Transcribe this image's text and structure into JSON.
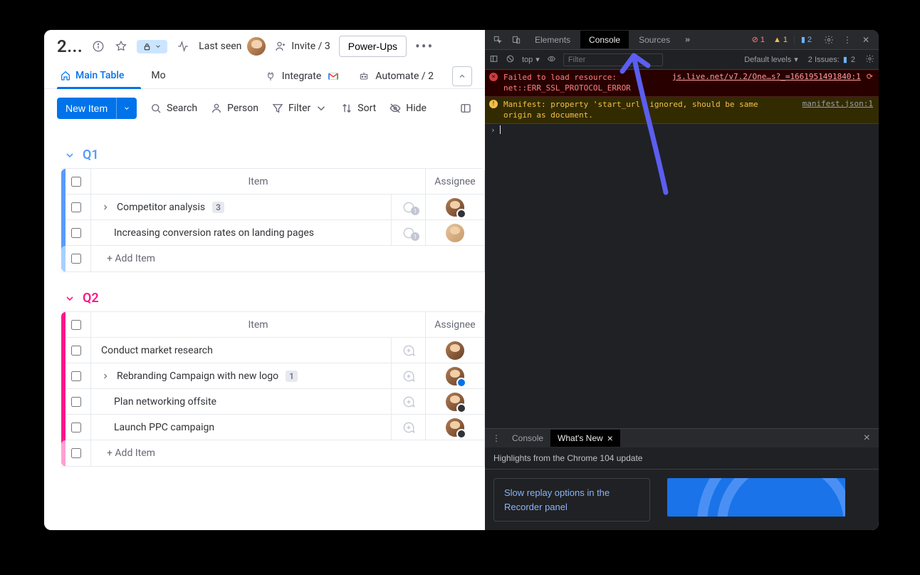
{
  "header": {
    "board_title": "2...",
    "last_seen_label": "Last seen",
    "invite_label": "Invite / 3",
    "powerups_label": "Power-Ups"
  },
  "view_tabs": {
    "main": "Main Table",
    "secondary": "Mo",
    "integrate": "Integrate",
    "automate": "Automate / 2"
  },
  "toolbar": {
    "new_item": "New Item",
    "search": "Search",
    "person": "Person",
    "filter": "Filter",
    "sort": "Sort",
    "hide": "Hide"
  },
  "columns": {
    "item": "Item",
    "assignee": "Assignee"
  },
  "groups": [
    {
      "id": "q1",
      "title": "Q1",
      "color": "blue",
      "rows": [
        {
          "name": "Competitor analysis",
          "badge": "3",
          "expandable": true,
          "chat_count": "1",
          "sub_badge": "moon"
        },
        {
          "name": "Increasing conversion rates on landing pages",
          "indent": true,
          "chat_count": "1",
          "avatar_variant": "light"
        }
      ],
      "add_label": "+ Add Item"
    },
    {
      "id": "q2",
      "title": "Q2",
      "color": "pink",
      "rows": [
        {
          "name": "Conduct market research",
          "chat_plus": true
        },
        {
          "name": "Rebranding Campaign with new logo",
          "badge": "1",
          "expandable": true,
          "chat_plus": true,
          "sub_badge": "home"
        },
        {
          "name": "Plan networking offsite",
          "indent": true,
          "chat_plus": true,
          "sub_badge": "moon"
        },
        {
          "name": "Launch PPC campaign",
          "indent": true,
          "chat_plus": true,
          "sub_badge": "dash"
        }
      ],
      "add_label": "+ Add Item"
    }
  ],
  "devtools": {
    "tabs": {
      "elements": "Elements",
      "console": "Console",
      "sources": "Sources"
    },
    "badges": {
      "err": "1",
      "warn": "1",
      "info": "2"
    },
    "filterbar": {
      "context": "top",
      "filter_placeholder": "Filter",
      "levels": "Default levels",
      "issues_label": "2 Issues:",
      "issues_count": "2"
    },
    "logs": [
      {
        "type": "err",
        "msg": "Failed to load resource:\nnet::ERR_SSL_PROTOCOL_ERROR",
        "src": "js.live.net/v7.2/One…s?_=1661951491840:1",
        "reload_icon": true
      },
      {
        "type": "warn",
        "msg": "Manifest: property 'start_url' ignored, should be same\norigin as document.",
        "src": "manifest.json:1"
      }
    ],
    "whatsnew": {
      "tab_console": "Console",
      "tab_whatsnew": "What's New",
      "header": "Highlights from the Chrome 104 update",
      "tip": "Slow replay options in the Recorder panel"
    }
  }
}
